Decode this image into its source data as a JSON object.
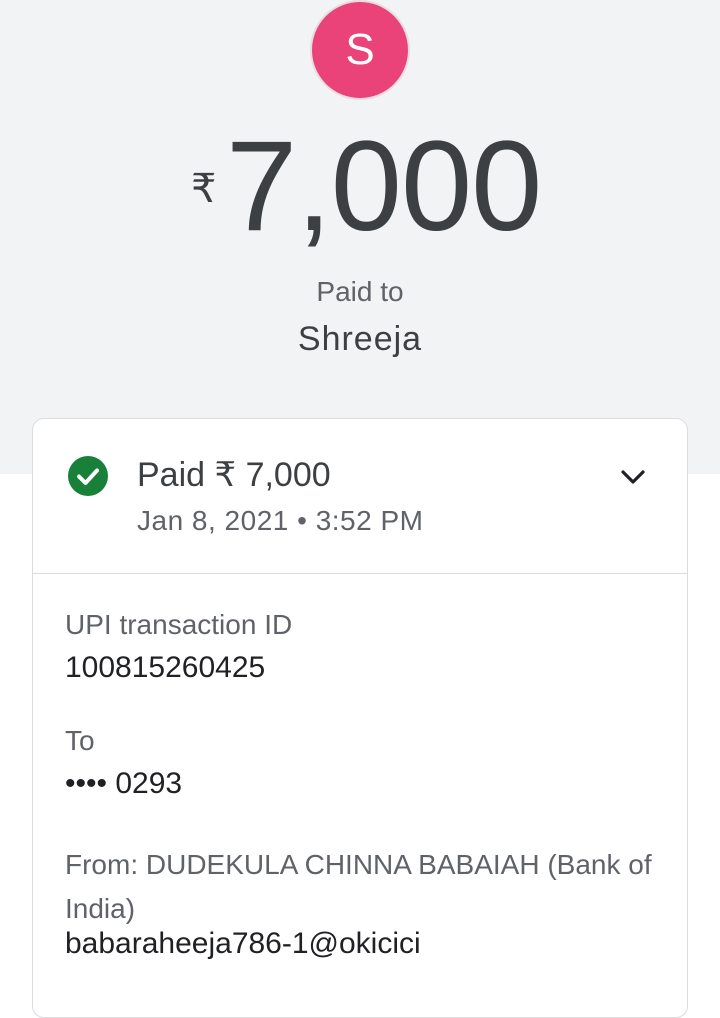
{
  "payee": {
    "avatar_initial": "S",
    "avatar_color": "#ea4379",
    "currency_symbol": "₹",
    "amount": "7,000",
    "paid_to_label": "Paid to",
    "name": "Shreeja"
  },
  "transaction": {
    "status_title": "Paid ₹ 7,000",
    "date_time": "Jan 8, 2021 • 3:52 PM",
    "status_icon": "check-circle-icon",
    "status_color": "#188038",
    "expand_icon": "chevron-down-icon"
  },
  "details": {
    "upi_id_label": "UPI transaction ID",
    "upi_id_value": "100815260425",
    "to_label": "To",
    "to_value": "•••• 0293",
    "from_label": "From: DUDEKULA CHINNA BABAIAH (Bank of India)",
    "from_value": "babaraheeja786-1@okicici"
  }
}
